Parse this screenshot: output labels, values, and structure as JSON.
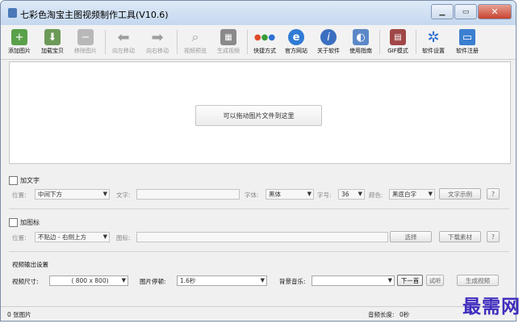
{
  "window": {
    "title": "七彩色淘宝主图视频制作工具(V10.6)"
  },
  "toolbar": {
    "items": [
      {
        "label": "添加图片",
        "icon": "add-image-icon",
        "enabled": true
      },
      {
        "label": "加载宝贝",
        "icon": "load-item-icon",
        "enabled": true
      },
      {
        "label": "移除图片",
        "icon": "remove-image-icon",
        "enabled": false
      },
      {
        "label": "向左移动",
        "icon": "arrow-left-icon",
        "enabled": false
      },
      {
        "label": "向右移动",
        "icon": "arrow-right-icon",
        "enabled": false
      },
      {
        "label": "视频预览",
        "icon": "magnifier-icon",
        "enabled": false
      },
      {
        "label": "生成视频",
        "icon": "clapper-icon",
        "enabled": false
      },
      {
        "label": "快捷方式",
        "icon": "shortcut-icon",
        "enabled": true
      },
      {
        "label": "官方网站",
        "icon": "browser-icon",
        "enabled": true
      },
      {
        "label": "关于软件",
        "icon": "info-icon",
        "enabled": true
      },
      {
        "label": "使用指南",
        "icon": "guide-icon",
        "enabled": true
      },
      {
        "label": "GIF模式",
        "icon": "gif-icon",
        "enabled": true
      },
      {
        "label": "软件设置",
        "icon": "settings-icon",
        "enabled": true
      },
      {
        "label": "软件注册",
        "icon": "monitor-icon",
        "enabled": true
      }
    ]
  },
  "drop_area": {
    "hint": "可以拖动图片文件到这里"
  },
  "text_section": {
    "checkbox_label": "加文字",
    "position_label": "位置:",
    "position_value": "中间下方",
    "text_label": "文字:",
    "text_value": "",
    "font_label": "字体:",
    "font_value": "黑体",
    "size_label": "字号:",
    "size_value": "36",
    "color_label": "颜色:",
    "color_value": "黑底白字",
    "sample_label": "文字示例",
    "help_label": "?"
  },
  "logo_section": {
    "checkbox_label": "加图标",
    "position_label": "位置:",
    "position_value": "不贴边 - 右侧上方",
    "icon_label": "图标:",
    "icon_value": "",
    "choose_label": "选择",
    "download_label": "下载素材",
    "help_label": "?"
  },
  "output_section": {
    "heading": "视频输出设置",
    "size_label": "视频尺寸:",
    "size_value": "( 800 x 800)",
    "pause_label": "图片停顿:",
    "pause_value": "1.6秒",
    "music_label": "背景音乐:",
    "music_value": "",
    "next_label": "下一首",
    "listen_label": "试听",
    "generate_label": "生成视频"
  },
  "status": {
    "image_count": "0 张图片",
    "duration_label": "音频长度:",
    "duration_value": "0秒"
  },
  "watermark": "最需网"
}
